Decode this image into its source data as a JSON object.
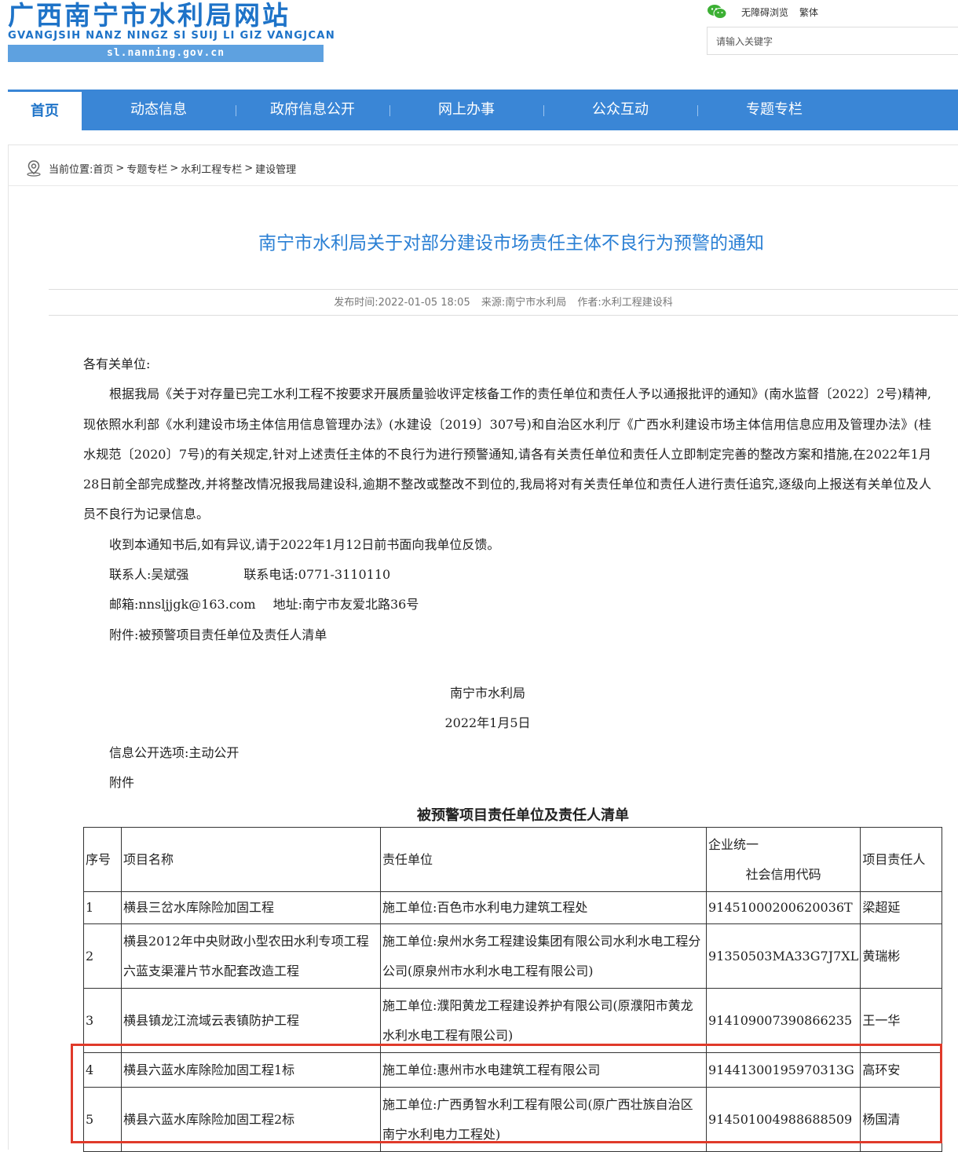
{
  "header": {
    "logo_title": "广西南宁市水利局网站",
    "logo_pinyin": "GVANGJSIH NANZ NINGZ SI SUIJ LI GIZ VANGJCAN",
    "logo_url": "sl.nanning.gov.cn",
    "accessibility_link": "无障碍浏览",
    "traditional_link": "繁体",
    "search_placeholder": "请输入关键字"
  },
  "nav": {
    "items": [
      "首页",
      "动态信息",
      "政府信息公开",
      "网上办事",
      "公众互动",
      "专题专栏"
    ]
  },
  "breadcrumb": {
    "prefix": "当前位置:",
    "items": [
      "首页",
      "专题专栏",
      "水利工程专栏",
      "建设管理"
    ],
    "separator": ">"
  },
  "article": {
    "title": "南宁市水利局关于对部分建设市场责任主体不良行为预警的通知",
    "publish_time": "发布时间:2022-01-05 18:05",
    "source": "来源:南宁市水利局",
    "author": "作者:水利工程建设科",
    "salutation": "各有关单位:",
    "para1": "根据我局《关于对存量已完工水利工程不按要求开展质量验收评定核备工作的责任单位和责任人予以通报批评的通知》(南水监督〔2022〕2号)精神,现依照水利部《水利建设市场主体信用信息管理办法》(水建设〔2019〕307号)和自治区水利厅《广西水利建设市场主体信用信息应用及管理办法》(桂水规范〔2020〕7号)的有关规定,针对上述责任主体的不良行为进行预警通知,请各有关责任单位和责任人立即制定完善的整改方案和措施,在2022年1月28日前全部完成整改,并将整改情况报我局建设科,逾期不整改或整改不到位的,我局将对有关责任单位和责任人进行责任追究,逐级向上报送有关单位及人员不良行为记录信息。",
    "para2": "收到本通知书后,如有异议,请于2022年1月12日前书面向我单位反馈。",
    "contact_person": "联系人:吴斌强",
    "contact_phone": "联系电话:0771-3110110",
    "email": "邮箱:nnsljjgk@163.com",
    "address": "地址:南宁市友爱北路36号",
    "attachment_line": "附件:被预警项目责任单位及责任人清单",
    "signature_org": "南宁市水利局",
    "signature_date": "2022年1月5日",
    "disclosure": "信息公开选项:主动公开",
    "attachment_label": "附件"
  },
  "table": {
    "title": "被预警项目责任单位及责任人清单",
    "headers": {
      "no": "序号",
      "project": "项目名称",
      "unit": "责任单位",
      "code_line1": "企业统一",
      "code_line2": "社会信用代码",
      "person": "项目责任人"
    },
    "rows": [
      {
        "no": "1",
        "project": "横县三岔水库除险加固工程",
        "unit": "施工单位:百色市水利电力建筑工程处",
        "code": "91451000200620036T",
        "person": "梁超延"
      },
      {
        "no": "2",
        "project": "横县2012年中央财政小型农田水利专项工程六蓝支渠灌片节水配套改造工程",
        "unit": "施工单位:泉州水务工程建设集团有限公司水利水电工程分公司(原泉州市水利水电工程有限公司)",
        "code": "91350503MA33G7J7XL",
        "person": "黄瑞彬"
      },
      {
        "no": "3",
        "project": "横县镇龙江流域云表镇防护工程",
        "unit": "施工单位:濮阳黄龙工程建设养护有限公司(原濮阳市黄龙水利水电工程有限公司)",
        "code": "914109007390866235",
        "person": "王一华"
      },
      {
        "no": "4",
        "project": "横县六蓝水库除险加固工程1标",
        "unit": "施工单位:惠州市水电建筑工程有限公司",
        "code": "91441300195970313G",
        "person": "高环安"
      },
      {
        "no": "5",
        "project": "横县六蓝水库除险加固工程2标",
        "unit": "施工单位:广西勇智水利工程有限公司(原广西壮族自治区南宁水利电力工程处)",
        "code": "914501004988688509",
        "person": "杨国清"
      }
    ]
  },
  "colors": {
    "brand_blue": "#1e73c8",
    "nav_blue": "#3a86d6",
    "title_blue": "#2a7fd4",
    "highlight_red": "#e03a2a"
  },
  "icons": [
    "wechat-icon",
    "location-pin-icon"
  ]
}
